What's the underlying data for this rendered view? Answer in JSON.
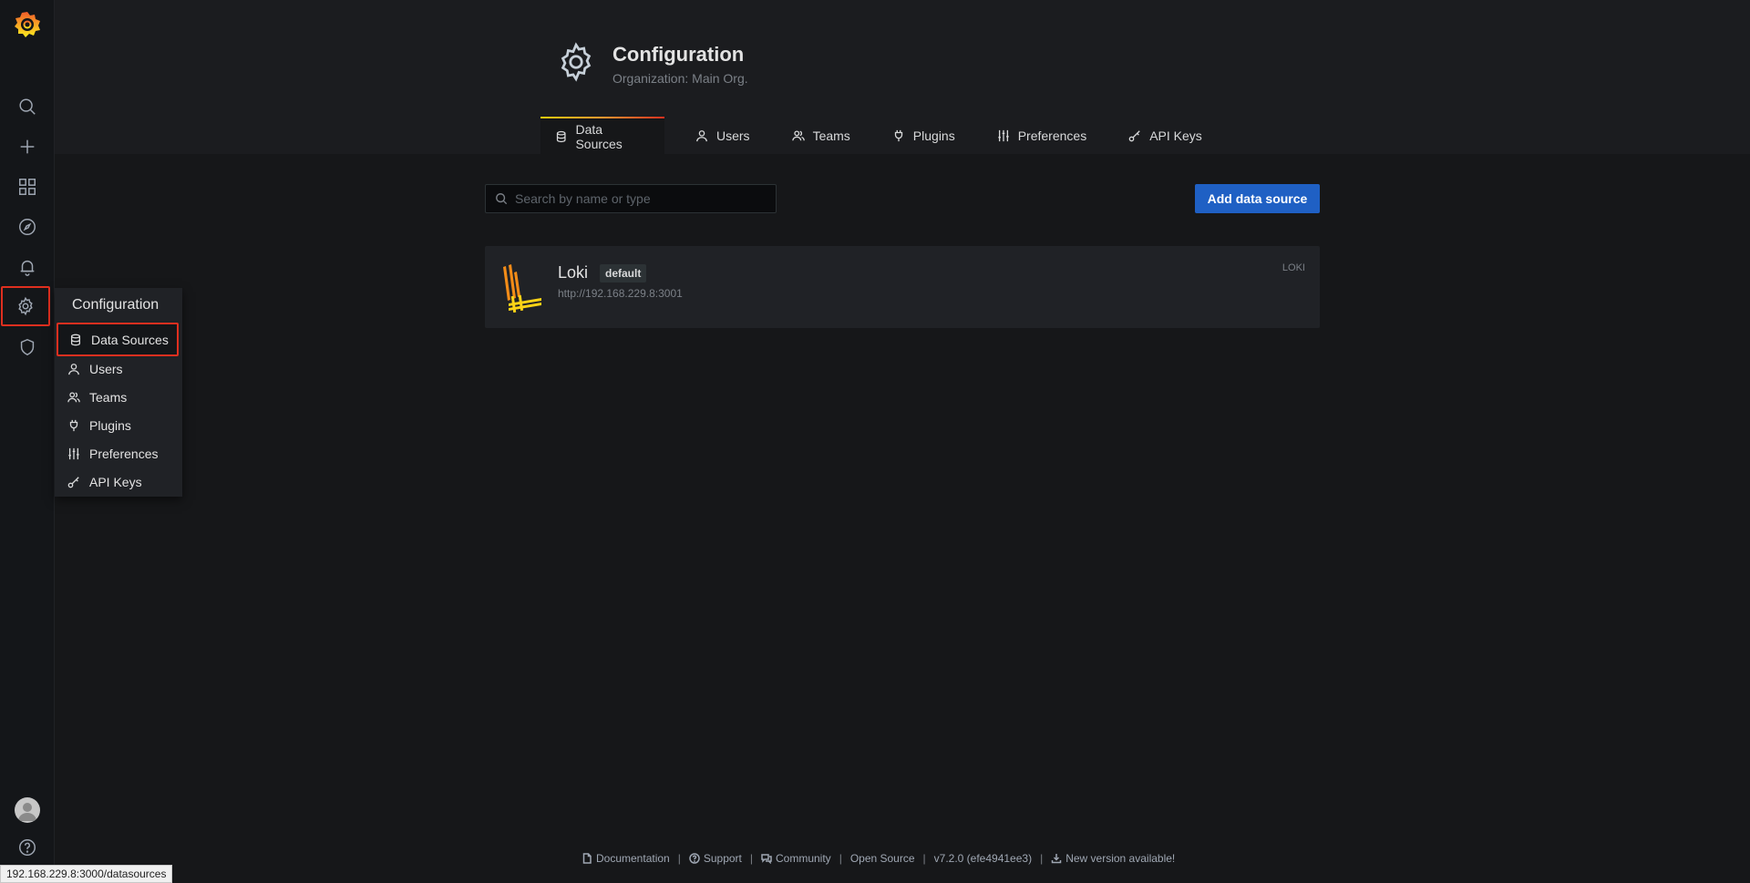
{
  "sidebar": {
    "logo_icon": "grafana-logo-icon",
    "items": [
      {
        "name": "search",
        "icon": "search-icon"
      },
      {
        "name": "create",
        "icon": "plus-icon"
      },
      {
        "name": "dashboards",
        "icon": "grid-icon"
      },
      {
        "name": "explore",
        "icon": "compass-icon"
      },
      {
        "name": "alerting",
        "icon": "bell-icon"
      },
      {
        "name": "configuration",
        "icon": "gear-icon",
        "active": true
      },
      {
        "name": "server-admin",
        "icon": "shield-icon"
      }
    ],
    "bottom": [
      {
        "name": "profile",
        "icon": "avatar"
      },
      {
        "name": "help",
        "icon": "help-icon"
      }
    ]
  },
  "flyout": {
    "title": "Configuration",
    "items": [
      {
        "label": "Data Sources",
        "icon": "database-icon"
      },
      {
        "label": "Users",
        "icon": "user-icon"
      },
      {
        "label": "Teams",
        "icon": "users-icon"
      },
      {
        "label": "Plugins",
        "icon": "plug-icon"
      },
      {
        "label": "Preferences",
        "icon": "sliders-icon"
      },
      {
        "label": "API Keys",
        "icon": "key-icon"
      }
    ]
  },
  "header": {
    "title": "Configuration",
    "subtitle": "Organization: Main Org.",
    "tabs": [
      {
        "label": "Data Sources",
        "icon": "database-icon",
        "active": true
      },
      {
        "label": "Users",
        "icon": "user-icon"
      },
      {
        "label": "Teams",
        "icon": "users-icon"
      },
      {
        "label": "Plugins",
        "icon": "plug-icon"
      },
      {
        "label": "Preferences",
        "icon": "sliders-icon"
      },
      {
        "label": "API Keys",
        "icon": "key-icon"
      }
    ]
  },
  "search": {
    "placeholder": "Search by name or type",
    "value": ""
  },
  "add_button": {
    "label": "Add data source"
  },
  "datasources": [
    {
      "name": "Loki",
      "badge": "default",
      "url": "http://192.168.229.8:3001",
      "type": "LOKI"
    }
  ],
  "footer": {
    "items": [
      {
        "label": "Documentation",
        "icon": "document-icon"
      },
      {
        "label": "Support",
        "icon": "question-circle-icon"
      },
      {
        "label": "Community",
        "icon": "comments-icon"
      },
      {
        "label": "Open Source",
        "icon": ""
      },
      {
        "label": "v7.2.0 (efe4941ee3)",
        "icon": ""
      },
      {
        "label": "New version available!",
        "icon": "download-icon"
      }
    ]
  },
  "status_url": "192.168.229.8:3000/datasources",
  "colors": {
    "accent_blue": "#1f60c4",
    "highlight_red": "#e02f1f",
    "background": "#161719",
    "sidebar": "#141619"
  }
}
